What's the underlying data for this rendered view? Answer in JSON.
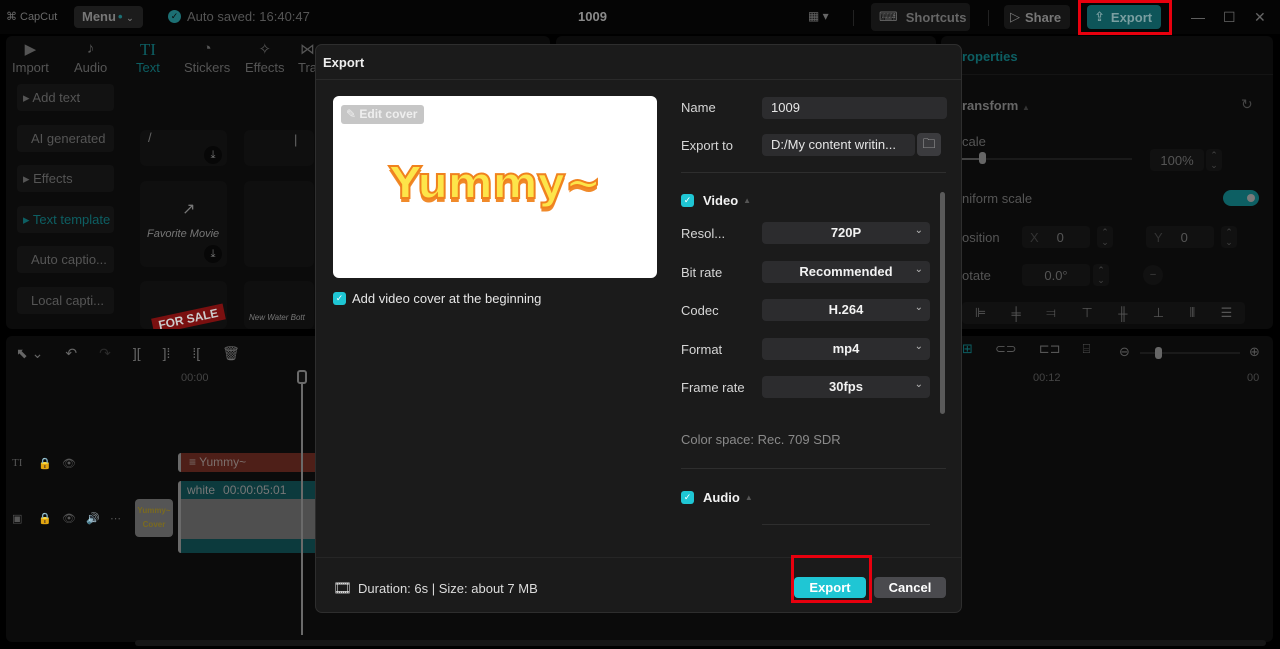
{
  "app": {
    "logo_text": "CapCut",
    "menu_label": "Menu",
    "autosave_text": "Auto saved: 16:40:47",
    "project_title": "1009",
    "shortcuts_label": "Shortcuts",
    "share_label": "Share",
    "export_label": "Export"
  },
  "toolbar": {
    "tabs": [
      {
        "label": "Import",
        "icon": "▶"
      },
      {
        "label": "Audio",
        "icon": "♪"
      },
      {
        "label": "Text",
        "icon": "TI"
      },
      {
        "label": "Stickers",
        "icon": "◔"
      },
      {
        "label": "Effects",
        "icon": "✧"
      },
      {
        "label": "Tra",
        "icon": "⋈"
      }
    ]
  },
  "left_sidebar": {
    "items": [
      {
        "label": "▸ Add text"
      },
      {
        "label": "AI generated"
      },
      {
        "label": "▸ Effects"
      },
      {
        "label": "▸ Text template"
      },
      {
        "label": "Auto captio..."
      },
      {
        "label": "Local capti..."
      }
    ]
  },
  "templates": {
    "favorite_movie": "Favorite Movie",
    "for_sale": "FOR SALE",
    "new_water": "New Water Bott"
  },
  "properties": {
    "title": "roperties",
    "transform": "ransform",
    "scale_label": "cale",
    "scale_value": "100%",
    "scale_fraction": 0.12,
    "uniform_scale_label": "niform scale",
    "uniform_scale_on": true,
    "position_label": "osition",
    "pos_x_label": "X",
    "pos_x": "0",
    "pos_y_label": "Y",
    "pos_y": "0",
    "rotate_label": "otate",
    "rotate_value": "0.0°"
  },
  "timeline": {
    "ruler": [
      "00:00",
      "00:12",
      "00"
    ],
    "text_clip": "Yummy~",
    "video_clip_name": "white",
    "video_clip_duration": "00:00:05:01",
    "cover_thumb_text": "Yummy~ Cover",
    "zoom_fraction": 0.18
  },
  "export_dialog": {
    "title": "Export",
    "edit_cover_label": "Edit cover",
    "cover_text": "Yummy~",
    "add_cover_label": "Add video cover at the beginning",
    "add_cover_checked": true,
    "name_label": "Name",
    "name_value": "1009",
    "export_to_label": "Export to",
    "export_to_value": "D:/My content writin...",
    "video_section": "Video",
    "video_checked": true,
    "fields": [
      {
        "label": "Resol...",
        "value": "720P"
      },
      {
        "label": "Bit rate",
        "value": "Recommended"
      },
      {
        "label": "Codec",
        "value": "H.264"
      },
      {
        "label": "Format",
        "value": "mp4"
      },
      {
        "label": "Frame rate",
        "value": "30fps"
      }
    ],
    "color_space": "Color space: Rec. 709 SDR",
    "audio_section": "Audio",
    "audio_checked": true,
    "footer_info": "Duration: 6s | Size: about 7 MB",
    "export_button": "Export",
    "cancel_button": "Cancel"
  },
  "colors": {
    "accent": "#1fc6d4",
    "highlight_box": "#e8000e"
  }
}
